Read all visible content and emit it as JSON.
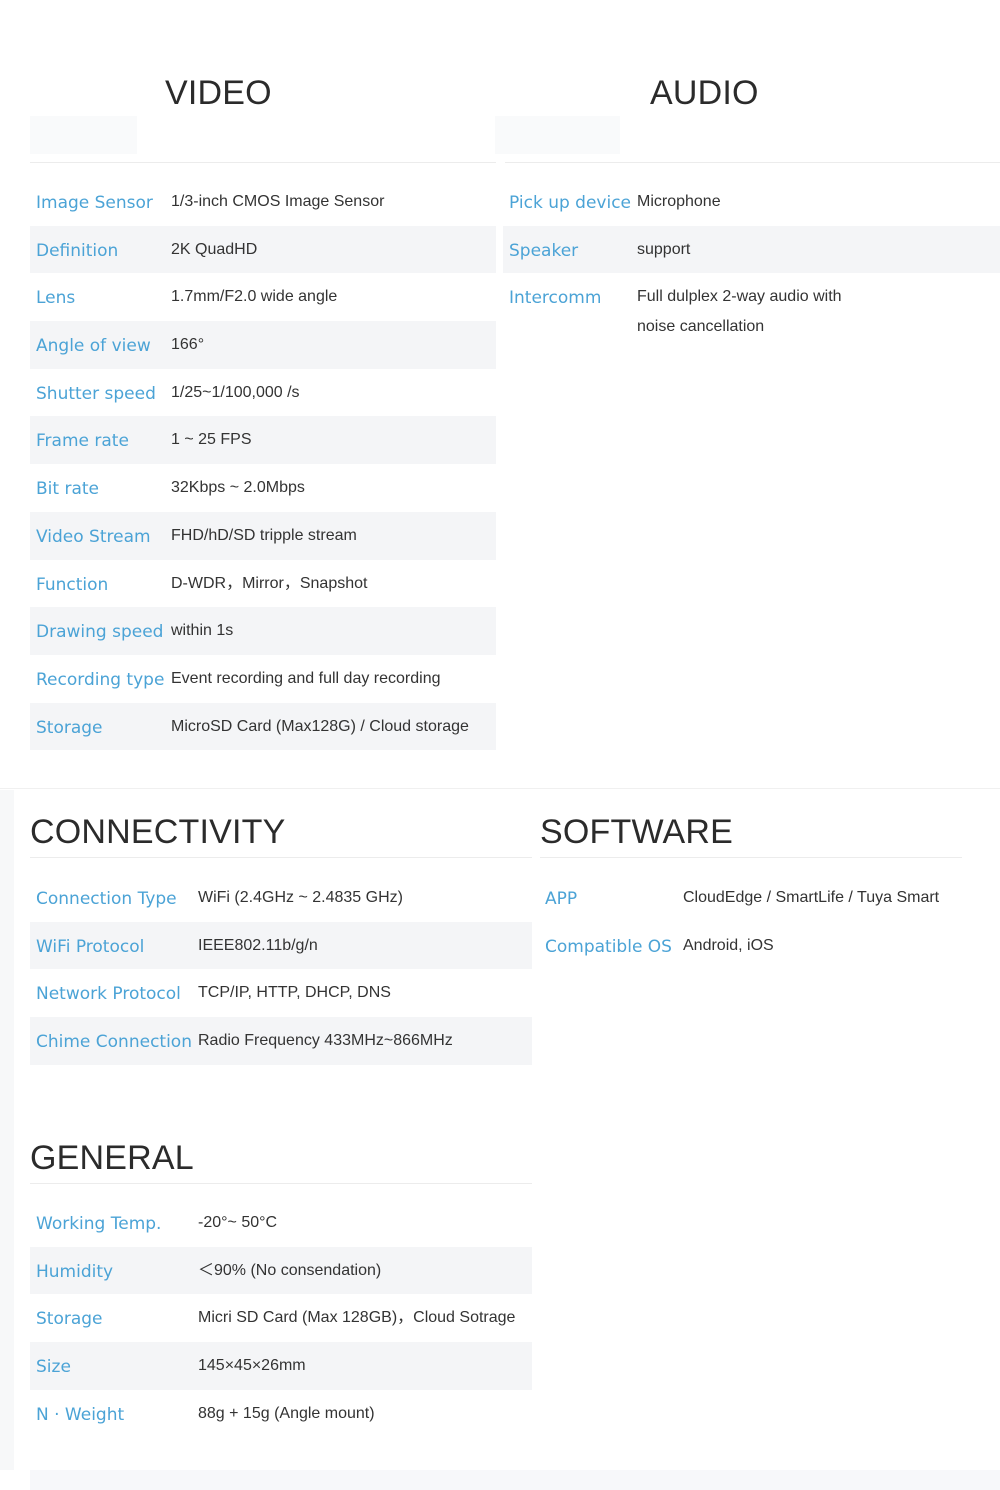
{
  "video": {
    "title": "VIDEO",
    "rows": [
      {
        "k": "Image Sensor",
        "v": "1/3-inch CMOS Image Sensor"
      },
      {
        "k": "Definition",
        "v": "2K QuadHD"
      },
      {
        "k": "Lens",
        "v": "1.7mm/F2.0 wide angle"
      },
      {
        "k": "Angle of view",
        "v": "166°"
      },
      {
        "k": "Shutter speed",
        "v": "1/25~1/100,000 /s"
      },
      {
        "k": "Frame rate",
        "v": "1 ~ 25 FPS"
      },
      {
        "k": "Bit rate",
        "v": "32Kbps ~ 2.0Mbps"
      },
      {
        "k": "Video Stream",
        "v": "FHD/hD/SD tripple stream"
      },
      {
        "k": "Function",
        "v": "D-WDR，Mirror，Snapshot"
      },
      {
        "k": "Drawing speed",
        "v": "within 1s"
      },
      {
        "k": "Recording type",
        "v": "Event recording and full day recording"
      },
      {
        "k": "Storage",
        "v": "MicroSD Card (Max128G) / Cloud storage"
      }
    ]
  },
  "audio": {
    "title": "AUDIO",
    "rows": [
      {
        "k": "Pick up device",
        "v": "Microphone"
      },
      {
        "k": "Speaker",
        "v": "support"
      },
      {
        "k": "Intercomm",
        "v": "Full dulplex 2-way audio with noise cancellation"
      }
    ]
  },
  "connectivity": {
    "title": "CONNECTIVITY",
    "rows": [
      {
        "k": "Connection Type",
        "v": "WiFi (2.4GHz ~ 2.4835 GHz)"
      },
      {
        "k": "WiFi Protocol",
        "v": "IEEE802.11b/g/n"
      },
      {
        "k": "Network Protocol",
        "v": "TCP/IP, HTTP, DHCP, DNS"
      },
      {
        "k": "Chime Connection",
        "v": "Radio Frequency 433MHz~866MHz"
      }
    ]
  },
  "software": {
    "title": "SOFTWARE",
    "rows": [
      {
        "k": "APP",
        "v": "CloudEdge / SmartLife / Tuya Smart"
      },
      {
        "k": "Compatible OS",
        "v": "Android, iOS"
      }
    ]
  },
  "general": {
    "title": "GENERAL",
    "rows": [
      {
        "k": "Working Temp.",
        "v": "-20°~ 50°C"
      },
      {
        "k": "Humidity",
        "v": "＜90% (No consendation)"
      },
      {
        "k": "Storage",
        "v": "Micri SD Card (Max 128GB)，Cloud Sotrage"
      },
      {
        "k": "Size",
        "v": "145×45×26mm"
      },
      {
        "k": "N · Weight",
        "v": "88g + 15g (Angle mount)"
      }
    ]
  },
  "colors": {
    "key": "#4ba3d6",
    "value": "#333333",
    "shade": "#f4f5f7"
  }
}
